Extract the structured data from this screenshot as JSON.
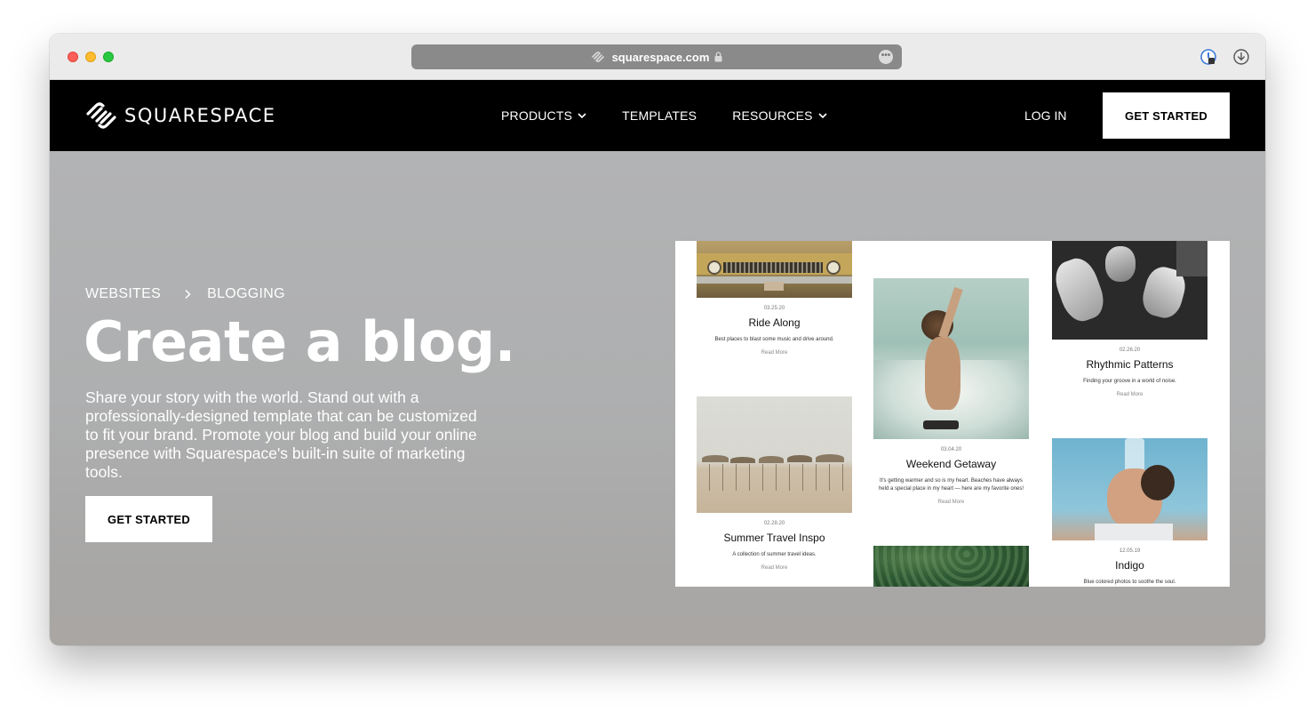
{
  "browser": {
    "url": "squarespace.com"
  },
  "nav": {
    "brand": "SQUARESPACE",
    "menu": [
      {
        "label": "PRODUCTS"
      },
      {
        "label": "TEMPLATES"
      },
      {
        "label": "RESOURCES"
      }
    ],
    "login_label": "LOG IN",
    "cta_label": "GET STARTED"
  },
  "hero": {
    "breadcrumb": [
      "WEBSITES",
      "BLOGGING"
    ],
    "headline": "Create a blog.",
    "subcopy": "Share your story with the world. Stand out with a professionally-designed template that can be customized to fit your brand. Promote your blog and build your online presence with Squarespace's built-in suite of marketing tools.",
    "cta_label": "GET STARTED"
  },
  "preview": {
    "posts": [
      {
        "date": "03.25.20",
        "title": "Ride Along",
        "desc": "Best places to blast some music and drive around.",
        "more": "Read More"
      },
      {
        "date": "02.28.20",
        "title": "Summer Travel Inspo",
        "desc": "A collection of summer travel ideas.",
        "more": "Read More"
      },
      {
        "date": "03.04.20",
        "title": "Weekend Getaway",
        "desc": "It's getting warmer and so is my heart. Beaches have always held a special place in my heart — here are my favorite ones!",
        "more": "Read More"
      },
      {
        "date": "02.26.20",
        "title": "Rhythmic Patterns",
        "desc": "Finding your groove in a world of noise.",
        "more": "Read More"
      },
      {
        "date": "12.05.19",
        "title": "Indigo",
        "desc": "Blue colored photos to soothe the soul."
      }
    ]
  },
  "colors": {
    "nav_bg": "#000000",
    "hero_bg": "#b0b1b2",
    "cta_bg": "#ffffff"
  }
}
